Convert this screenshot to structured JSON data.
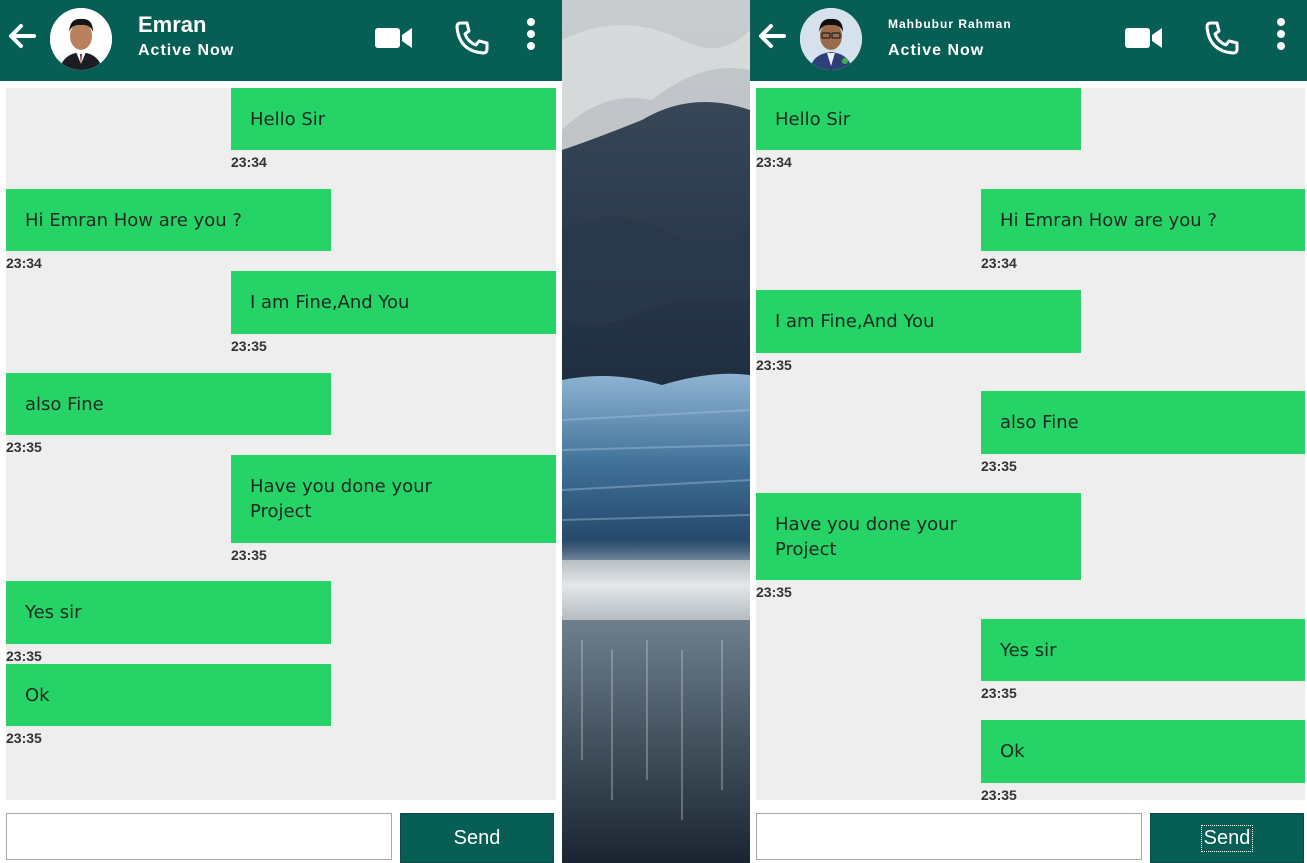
{
  "left_chat": {
    "contact_name": "Emran",
    "status": "Active Now",
    "messages": [
      {
        "side": "right",
        "text": "Hello Sir",
        "time": "23:34"
      },
      {
        "side": "left",
        "text": "Hi Emran How are you ?",
        "time": "23:34"
      },
      {
        "side": "right",
        "text": "I am Fine,And You",
        "time": "23:35"
      },
      {
        "side": "left",
        "text": "also Fine",
        "time": "23:35"
      },
      {
        "side": "right",
        "text": "Have you done your\nProject",
        "time": "23:35"
      },
      {
        "side": "left",
        "text": "Yes sir",
        "time": "23:35"
      },
      {
        "side": "left",
        "text": "Ok",
        "time": "23:35"
      }
    ],
    "input_value": "",
    "send_label": "Send"
  },
  "right_chat": {
    "contact_name": "Mahbubur Rahman",
    "status": "Active Now",
    "messages": [
      {
        "side": "left",
        "text": "Hello Sir",
        "time": "23:34"
      },
      {
        "side": "right",
        "text": "Hi Emran How are you ?",
        "time": "23:34"
      },
      {
        "side": "left",
        "text": "I am Fine,And You",
        "time": "23:35"
      },
      {
        "side": "right",
        "text": "also Fine",
        "time": "23:35"
      },
      {
        "side": "left",
        "text": "Have you done your\nProject",
        "time": "23:35"
      },
      {
        "side": "right",
        "text": "Yes sir",
        "time": "23:35"
      },
      {
        "side": "right",
        "text": "Ok",
        "time": "23:35"
      }
    ],
    "input_value": "",
    "send_label": "Send"
  },
  "colors": {
    "header": "#075e54",
    "bubble": "#25d366",
    "chat_background": "#eeeeee"
  },
  "icons": [
    "back-arrow-icon",
    "video-camera-icon",
    "phone-icon",
    "more-vertical-icon"
  ]
}
